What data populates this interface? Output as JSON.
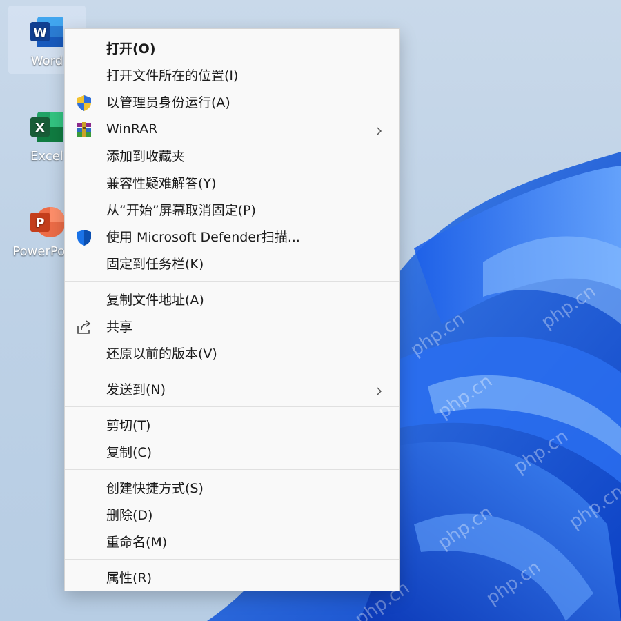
{
  "desktop": {
    "icons": [
      {
        "label": "Word",
        "icon": "word-app-icon",
        "color": "#2b6bd6",
        "letter": "W",
        "selected": true
      },
      {
        "label": "Excel",
        "icon": "excel-app-icon",
        "color": "#1d7a45",
        "letter": "X",
        "selected": false
      },
      {
        "label": "PowerPoint",
        "icon": "powerpoint-app-icon",
        "color": "#d2512b",
        "letter": "P",
        "selected": false
      }
    ],
    "watermark_text": "php.cn"
  },
  "context_menu": {
    "groups": [
      [
        {
          "label": "打开(O)",
          "bold": true
        },
        {
          "label": "打开文件所在的位置(I)"
        },
        {
          "label": "以管理员身份运行(A)",
          "icon": "uac-shield-icon"
        },
        {
          "label": "WinRAR",
          "icon": "winrar-icon",
          "submenu": true
        },
        {
          "label": "添加到收藏夹"
        },
        {
          "label": "兼容性疑难解答(Y)"
        },
        {
          "label": "从“开始”屏幕取消固定(P)"
        },
        {
          "label": "使用 Microsoft Defender扫描...",
          "icon": "defender-shield-icon"
        },
        {
          "label": "固定到任务栏(K)"
        }
      ],
      [
        {
          "label": "复制文件地址(A)"
        },
        {
          "label": "共享",
          "icon": "share-icon"
        },
        {
          "label": "还原以前的版本(V)"
        }
      ],
      [
        {
          "label": "发送到(N)",
          "submenu": true
        }
      ],
      [
        {
          "label": "剪切(T)"
        },
        {
          "label": "复制(C)"
        }
      ],
      [
        {
          "label": "创建快捷方式(S)"
        },
        {
          "label": "删除(D)"
        },
        {
          "label": "重命名(M)"
        }
      ],
      [
        {
          "label": "属性(R)"
        }
      ]
    ]
  }
}
